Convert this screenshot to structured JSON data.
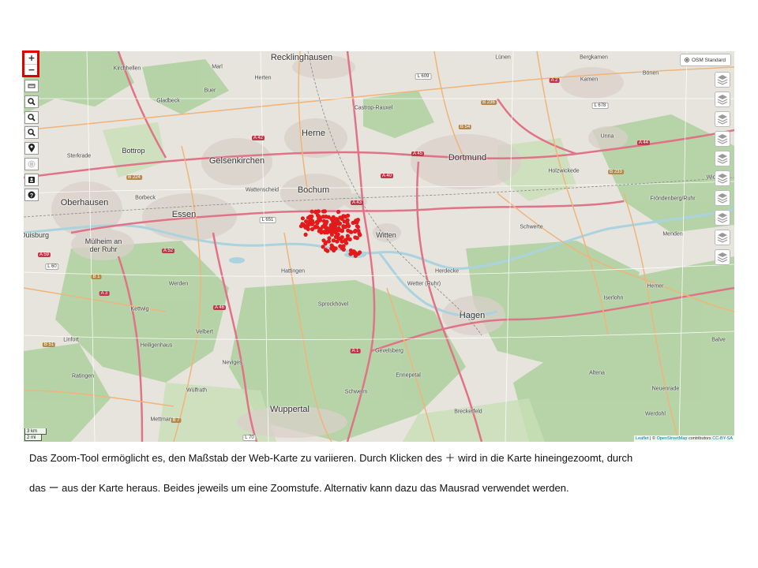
{
  "map": {
    "zoom_in_label": "+",
    "zoom_out_label": "−",
    "layer_option": "OSM Standard",
    "scale_km": "3 km",
    "scale_mi": "2 mi",
    "attribution": {
      "leaflet": "Leaflet",
      "separator": " | © ",
      "osm": "OpenStreetMap",
      "contributors": " contributors ",
      "license": "CC-BY-SA"
    },
    "cities_big": [
      "Recklinghausen",
      "Herne",
      "Gelsenkirchen",
      "Bochum",
      "Dortmund",
      "Essen",
      "Oberhausen",
      "Mülheim an der Ruhr",
      "Witten",
      "Hagen",
      "Wuppertal",
      "Bottrop"
    ],
    "cities_med": [
      "Castrop-Rauxel",
      "Lünen",
      "Kamen",
      "Unna",
      "Holzwickede",
      "Schwerte",
      "Herdecke",
      "Wetter (Ruhr)",
      "Hattingen",
      "Sprockhövel",
      "Gevelsberg",
      "Ennepetal",
      "Schwelm",
      "Velbert",
      "Heiligenhaus",
      "Ratingen",
      "Mettmann",
      "Wülfrath",
      "Neviges",
      "Kettwig",
      "Werden",
      "Iserlohn",
      "Menden",
      "Hemer",
      "Altena",
      "Neuenrade",
      "Breckerfeld",
      "Fröndenberg/Ruhr",
      "Bönen",
      "Wickede",
      "Balve",
      "Linfort",
      "Kirchhellen",
      "Gladbeck",
      "Marl",
      "Herten",
      "Buer",
      "Sterkrade",
      "Borbeck",
      "Wattenscheid",
      "Werdohl",
      "Bergkamen",
      "Duisburg"
    ],
    "roads": [
      "A 2",
      "A 43",
      "A 42",
      "A 40",
      "A 45",
      "A 1",
      "A 44",
      "A 52",
      "A 46",
      "A 3",
      "A 59",
      "B 1",
      "B 7",
      "B 54",
      "B 236",
      "B 233",
      "L 609",
      "L 651",
      "L 70",
      "L 678",
      "B 51",
      "B 224",
      "L 60"
    ],
    "colors": {
      "data_point": "#e31a1c",
      "highlight": "#e00000",
      "motorway": "#c1364a",
      "primary": "#e8a06a",
      "forest": "#add19e",
      "urban": "#d9d0c9",
      "water": "#aad3df"
    }
  },
  "tools": [
    "ruler-icon",
    "zoom-box-icon",
    "zoom-search-icon",
    "search-icon",
    "location-marker-icon",
    "print-icon",
    "user-card-icon",
    "help-icon"
  ],
  "layer_buttons_count": 10,
  "caption": {
    "line1": "Das Zoom-Tool ermöglicht es, den Maßstab der Web-Karte zu variieren. Durch Klicken des  ＋  wird in die Karte hineingezoomt, durch",
    "line2": "das  ー aus der Karte heraus. Beides jeweils um eine Zoomstufe. Alternativ kann dazu das Mausrad verwendet  werden."
  }
}
